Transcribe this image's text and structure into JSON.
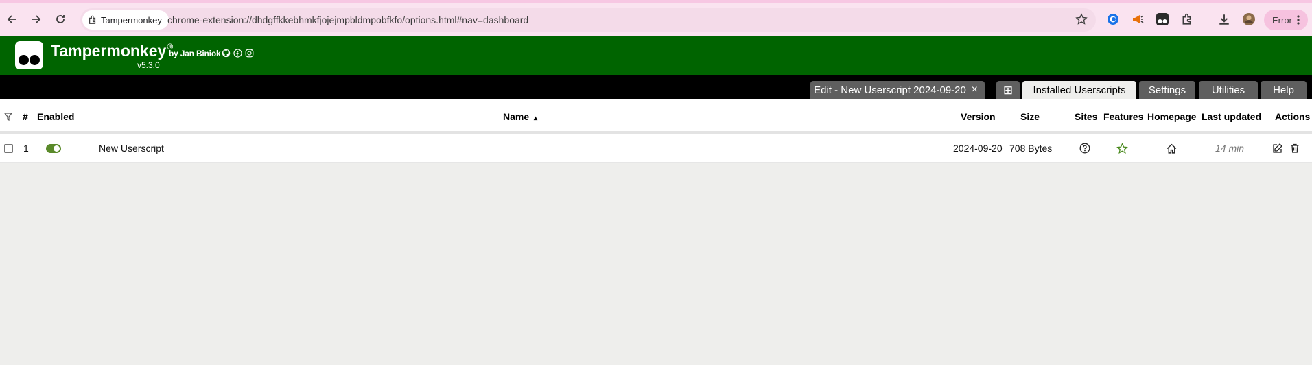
{
  "browser": {
    "site_chip": "Tampermonkey",
    "url": "chrome-extension://dhdgffkkebhmkfjojejmpbldmpobfkfo/options.html#nav=dashboard",
    "profile_status": "Error",
    "accent_color": "#fae3f0"
  },
  "header": {
    "title": "Tampermonkey",
    "registered": "®",
    "version": "v5.3.0",
    "byline": "by Jan Biniok",
    "brand_color": "#006400"
  },
  "tabs": [
    {
      "label": "Edit - New Userscript 2024-09-20",
      "close": "×"
    },
    {
      "label": "⊞"
    },
    {
      "label": "Installed Userscripts"
    },
    {
      "label": "Settings"
    },
    {
      "label": "Utilities"
    },
    {
      "label": "Help"
    }
  ],
  "table": {
    "columns": {
      "num": "#",
      "enabled": "Enabled",
      "name": "Name",
      "sort_indicator": "▴",
      "version": "Version",
      "size": "Size",
      "sites": "Sites",
      "features": "Features",
      "homepage": "Homepage",
      "last_updated": "Last updated",
      "actions": "Actions"
    },
    "rows": [
      {
        "num": "1",
        "name": "New Userscript",
        "version": "2024-09-20",
        "size": "708 Bytes",
        "last_updated": "14 min",
        "enabled": true
      }
    ]
  }
}
